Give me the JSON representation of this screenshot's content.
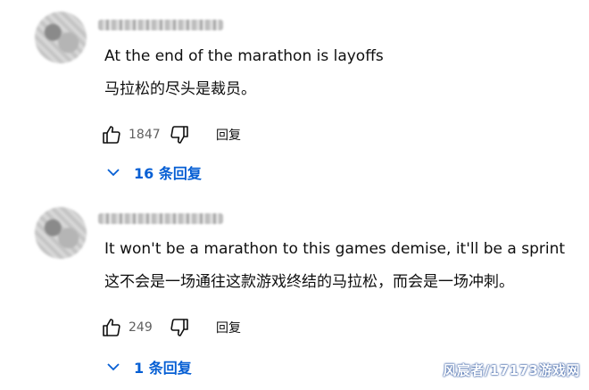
{
  "comments": [
    {
      "text_en": "At the end of the marathon is layoffs",
      "text_zh": "马拉松的尽头是裁员。",
      "like_count": "1847",
      "reply_label": "回复",
      "replies_toggle": "16 条回复"
    },
    {
      "text_en": "It won't be a marathon to this games demise, it'll be a sprint",
      "text_zh": "这不会是一场通往这款游戏终结的马拉松，而会是一场冲刺。",
      "like_count": "249",
      "reply_label": "回复",
      "replies_toggle": "1 条回复"
    }
  ],
  "watermark": "风宸者/17173游戏网",
  "colors": {
    "link_blue": "#065fd4",
    "count_gray": "#606060"
  },
  "icons": [
    "thumbs-up-icon",
    "thumbs-down-icon",
    "chevron-down-icon"
  ]
}
